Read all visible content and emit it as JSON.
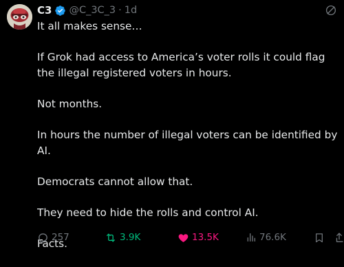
{
  "author": {
    "display_name": "C3",
    "handle": "@C_3C_3",
    "separator": "·",
    "time": "1d",
    "verified": true,
    "verified_color": "#1d9bf0",
    "avatar_icon": "avatar-image"
  },
  "tweet": {
    "paragraphs": [
      "It all makes sense…",
      "If Grok had access to America’s voter rolls it could flag the illegal registered voters in hours.",
      "Not months.",
      "In hours the number of illegal voters can be identified by AI.",
      "Democrats cannot allow that.",
      "They need to hide the rolls and control AI.",
      "Facts."
    ]
  },
  "actions": {
    "reply": {
      "count": "257",
      "icon": "reply-icon"
    },
    "retweet": {
      "count": "3.9K",
      "icon": "retweet-icon",
      "color": "#00ba7c"
    },
    "like": {
      "count": "13.5K",
      "icon": "heart-icon",
      "color": "#f91880"
    },
    "views": {
      "count": "76.6K",
      "icon": "views-icon"
    },
    "bookmark": {
      "icon": "bookmark-icon"
    },
    "share": {
      "icon": "share-icon"
    }
  },
  "colors": {
    "background": "#000000",
    "text": "#e7e9ea",
    "muted": "#71767b"
  }
}
